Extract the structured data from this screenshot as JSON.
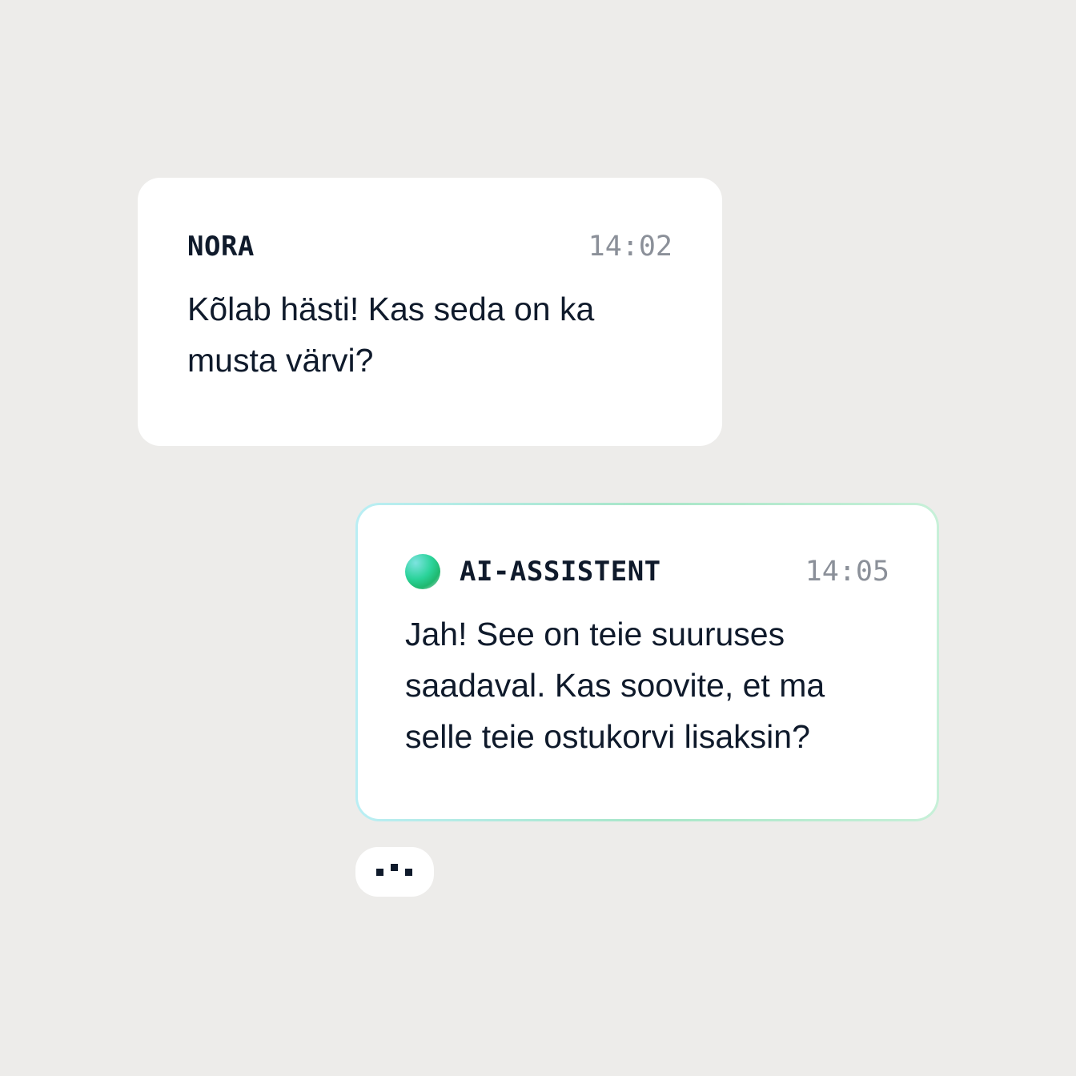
{
  "messages": [
    {
      "sender": "NORA",
      "time": "14:02",
      "text": "Kõlab hästi! Kas seda on ka musta värvi?"
    },
    {
      "sender": "AI-ASSISTENT",
      "time": "14:05",
      "text": "Jah! See on teie suuruses saadaval. Kas soovite, et ma selle teie ostukorvi lisaksin?",
      "avatar_icon": "assistant-orb-icon"
    }
  ],
  "typing_indicator": {
    "icon": "typing-dots-icon"
  },
  "colors": {
    "background": "#edecea",
    "bubble": "#ffffff",
    "text": "#0f1a2b",
    "timestamp": "#8b9099",
    "assistant_border_start": "#b9eef4",
    "assistant_border_end": "#a8e6c8"
  }
}
